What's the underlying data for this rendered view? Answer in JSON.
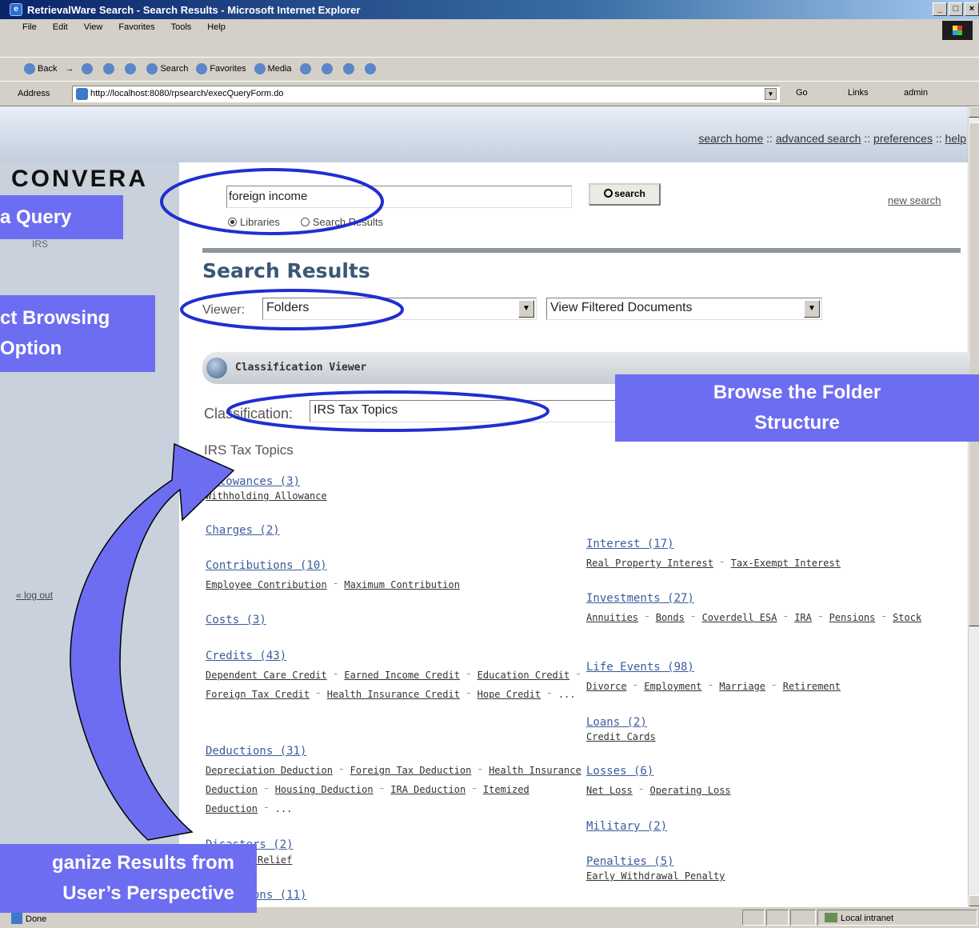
{
  "browser": {
    "title": "RetrievalWare Search - Search Results - Microsoft Internet Explorer",
    "window_buttons": [
      "_",
      "□",
      "×"
    ],
    "menus": [
      "File",
      "Edit",
      "View",
      "Favorites",
      "Tools",
      "Help"
    ],
    "toolbar": [
      "Back",
      "→",
      "Search",
      "Favorites",
      "Media"
    ],
    "address_label": "Address",
    "url": "http://localhost:8080/rpsearch/execQueryForm.do",
    "go": "Go",
    "links": "Links",
    "admin": "admin",
    "status": "Done",
    "zone": "Local intranet"
  },
  "header": {
    "links": [
      "search home",
      "advanced search",
      "preferences",
      "help"
    ],
    "separator": "::"
  },
  "sidebar": {
    "logo": "CONVERA",
    "repository": "IRS",
    "logout": "« log out"
  },
  "search": {
    "query": "foreign income",
    "button": "search",
    "new_search": "new search",
    "scope_options": [
      "Libraries",
      "Search Results"
    ],
    "scope_selected": "Libraries"
  },
  "results": {
    "title": "Search Results",
    "viewer_label": "Viewer:",
    "viewer_value": "Folders",
    "filter_value": "View Filtered Documents"
  },
  "classification": {
    "panel_title": "Classification Viewer",
    "label": "Classification:",
    "value": "IRS Tax Topics",
    "tree_title": "IRS Tax Topics",
    "left_column": [
      {
        "name": "Allowances (3)",
        "subs": [
          "Withholding Allowance"
        ]
      },
      {
        "name": "Charges (2)",
        "subs": []
      },
      {
        "name": "Contributions (10)",
        "subs": [
          "Employee Contribution",
          "Maximum Contribution"
        ]
      },
      {
        "name": "Costs (3)",
        "subs": []
      },
      {
        "name": "Credits (43)",
        "subs": [
          "Dependent Care Credit",
          "Earned Income Credit",
          "Education Credit",
          "Foreign Tax Credit",
          "Health Insurance Credit",
          "Hope Credit",
          "..."
        ]
      },
      {
        "name": "Deductions (31)",
        "subs": [
          "Depreciation Deduction",
          "Foreign Tax Deduction",
          "Health Insurance Deduction",
          "Housing Deduction",
          "IRA Deduction",
          "Itemized Deduction",
          "..."
        ]
      },
      {
        "name": "Disasters (2)",
        "subs": [
          "Disaster Relief"
        ]
      },
      {
        "name": "Exemptions (11)",
        "subs": []
      }
    ],
    "right_column": [
      {
        "name": "Interest (17)",
        "subs": [
          "Real Property Interest",
          "Tax-Exempt Interest"
        ]
      },
      {
        "name": "Investments (27)",
        "subs": [
          "Annuities",
          "Bonds",
          "Coverdell ESA",
          "IRA",
          "Pensions",
          "Stock"
        ]
      },
      {
        "name": "Life Events (98)",
        "subs": [
          "Divorce",
          "Employment",
          "Marriage",
          "Retirement"
        ]
      },
      {
        "name": "Loans (2)",
        "subs": [
          "Credit Cards"
        ]
      },
      {
        "name": "Losses (6)",
        "subs": [
          "Net Loss",
          "Operating Loss"
        ]
      },
      {
        "name": "Military (2)",
        "subs": []
      },
      {
        "name": "Penalties (5)",
        "subs": [
          "Early Withdrawal Penalty"
        ]
      }
    ]
  },
  "callouts": {
    "query": "a Query",
    "browsing": [
      "ct Browsing",
      "Option"
    ],
    "browse_folder": [
      "Browse the Folder",
      "Structure"
    ],
    "organize": [
      "ganize Results from",
      "User’s Perspective"
    ]
  },
  "colors": {
    "callout": "#6d6df2",
    "arrow": "#6d6df2",
    "ellipse": "#1f2fd0",
    "title_blue": "#3b5775",
    "link_blue": "#3b5c9a"
  }
}
